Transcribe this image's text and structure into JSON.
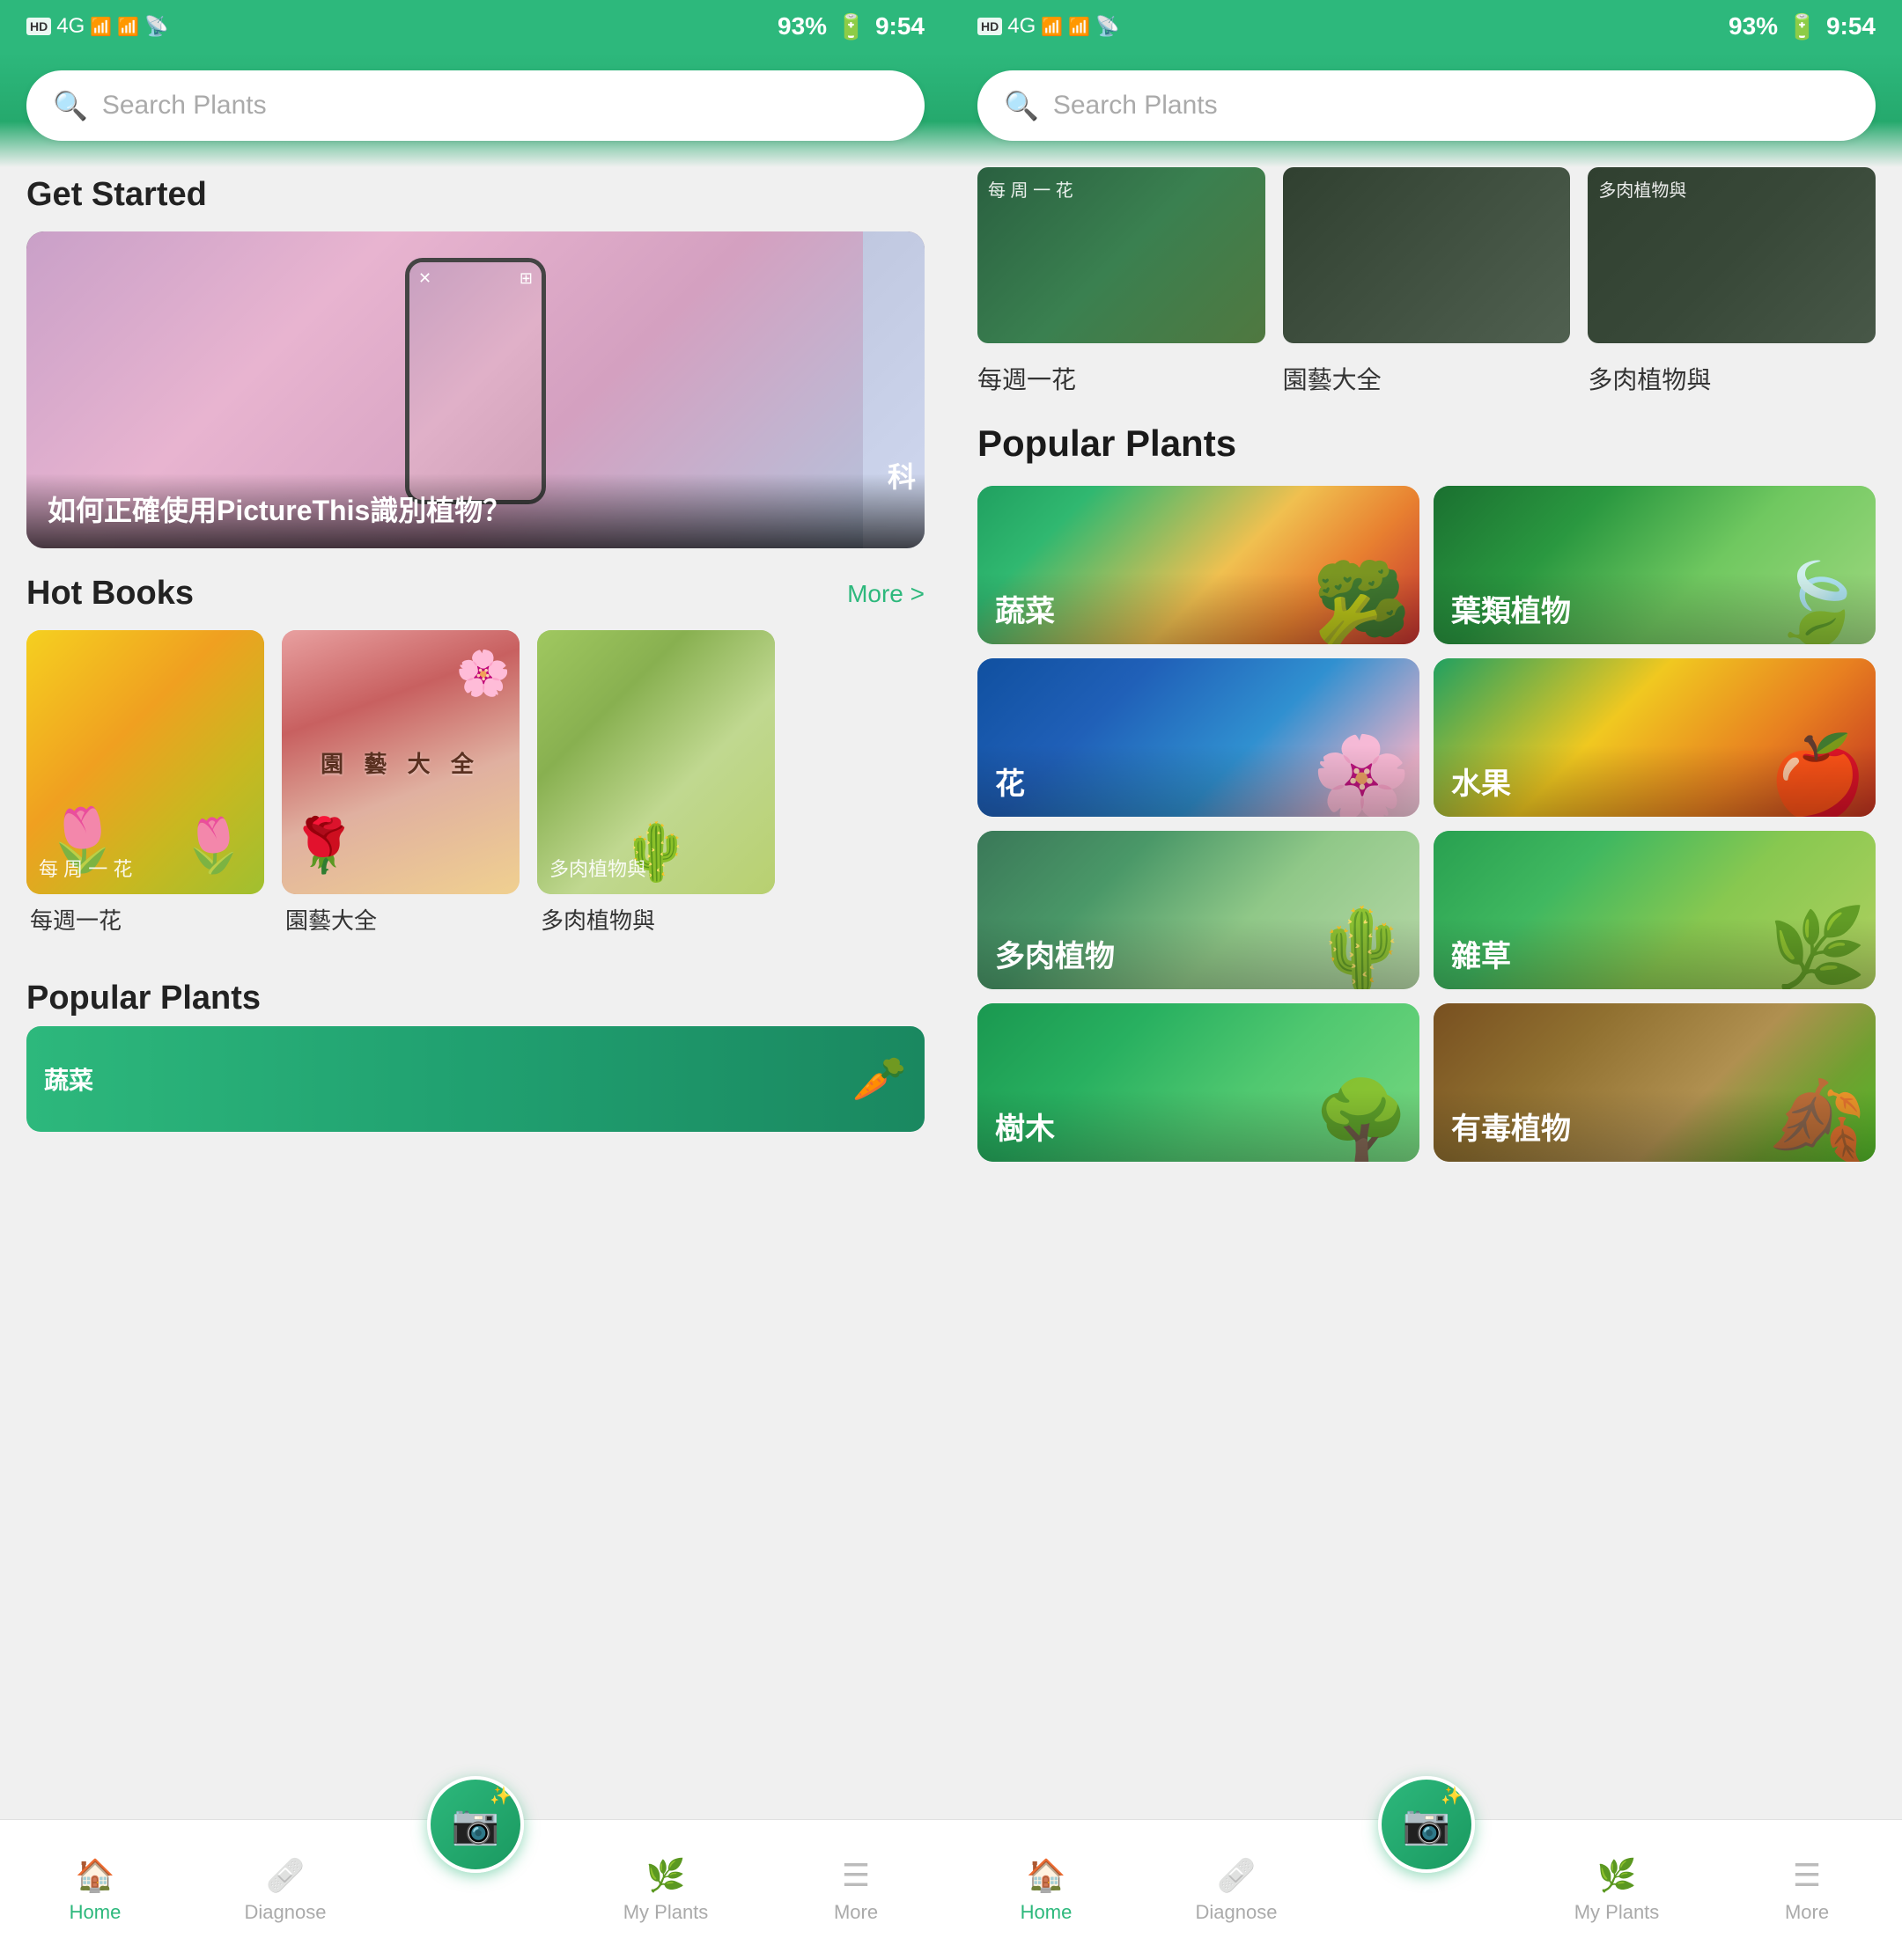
{
  "app": {
    "name": "PictureThis"
  },
  "status_bar": {
    "signal": "HD 4G 4G",
    "battery": "93%",
    "time": "9:54"
  },
  "search": {
    "placeholder": "Search Plants"
  },
  "left_panel": {
    "get_started_label": "Get Started",
    "article": {
      "title": "如何正確使用PictureThis識別植物？"
    },
    "hot_books": {
      "section_title": "Hot Books",
      "more_label": "More >",
      "books": [
        {
          "label": "每 周 一 花",
          "name": "每週一花"
        },
        {
          "label": "園 藝 大 全",
          "name": "園藝大全"
        },
        {
          "label": "多肉植物與",
          "name": "多肉植物與"
        }
      ]
    },
    "popular_plants": {
      "section_title": "Popular Plants"
    }
  },
  "right_panel": {
    "books_top": {
      "labels": [
        "每 周 一 花",
        "園藝大全",
        "多肉植物與"
      ],
      "names": [
        "每週一花",
        "園藝大全",
        "多肉植物與"
      ]
    },
    "popular_plants": {
      "section_title": "Popular Plants",
      "plants": [
        {
          "label": "蔬菜",
          "type": "veggies"
        },
        {
          "label": "葉類植物",
          "type": "leaves"
        },
        {
          "label": "花",
          "type": "flowers"
        },
        {
          "label": "水果",
          "type": "fruits"
        },
        {
          "label": "多肉植物",
          "type": "succulent"
        },
        {
          "label": "雜草",
          "type": "weeds"
        },
        {
          "label": "樹木",
          "type": "trees"
        },
        {
          "label": "有毒植物",
          "type": "toxic"
        }
      ]
    }
  },
  "bottom_nav": {
    "items": [
      {
        "icon": "🏠",
        "label": "Home",
        "active": true
      },
      {
        "icon": "🩺",
        "label": "Diagnose",
        "active": false
      },
      {
        "icon": "📷",
        "label": "",
        "active": false,
        "is_fab": true
      },
      {
        "icon": "🌿",
        "label": "My Plants",
        "active": false
      },
      {
        "icon": "☰",
        "label": "More",
        "active": false
      }
    ]
  }
}
